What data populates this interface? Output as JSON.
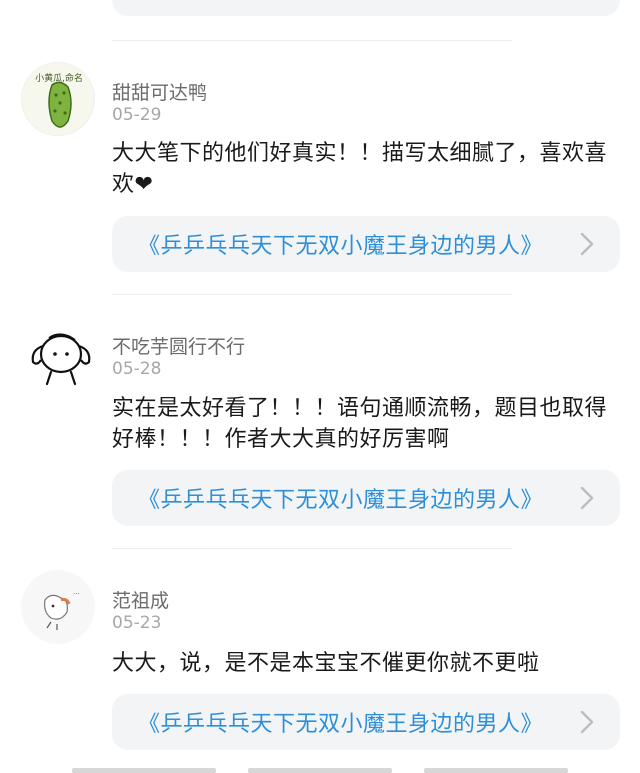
{
  "book_title": "《乒乒乓乓天下无双小魔王身边的男人》",
  "comments": [
    {
      "username": "甜甜可达鸭",
      "date": "05-29",
      "avatar_icon": "cucumber-avatar-icon",
      "avatar_text": "小黄瓜,命名",
      "content": "大大笔下的他们好真实！！描写太细腻了，喜欢喜欢❤"
    },
    {
      "username": "不吃芋圆行不行",
      "date": "05-28",
      "avatar_icon": "doodle-girl-avatar-icon",
      "content": "实在是太好看了！！！语句通顺流畅，题目也取得好棒！！！作者大大真的好厉害啊"
    },
    {
      "username": "范祖成",
      "date": "05-23",
      "avatar_icon": "cat-sketch-avatar-icon",
      "content": "大大，说，是不是本宝宝不催更你就不更啦"
    }
  ]
}
